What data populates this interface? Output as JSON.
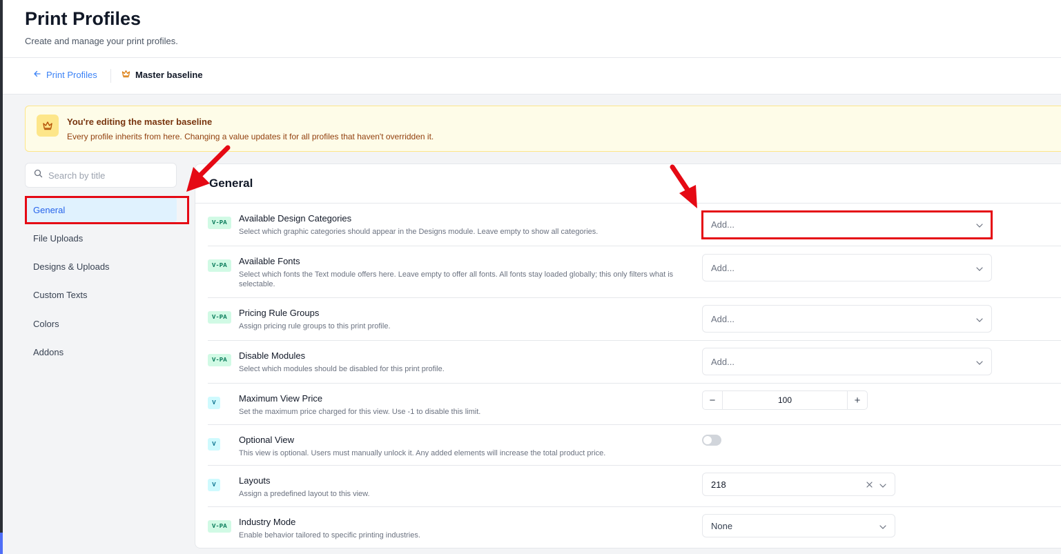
{
  "header": {
    "title": "Print Profiles",
    "subtitle": "Create and manage your print profiles."
  },
  "breadcrumb": {
    "back_label": "Print Profiles",
    "current_label": "Master baseline"
  },
  "banner": {
    "title": "You're editing the master baseline",
    "text": "Every profile inherits from here. Changing a value updates it for all profiles that haven't overridden it."
  },
  "sidebar": {
    "search_placeholder": "Search by title",
    "items": [
      {
        "label": "General",
        "active": true
      },
      {
        "label": "File Uploads"
      },
      {
        "label": "Designs & Uploads"
      },
      {
        "label": "Custom Texts"
      },
      {
        "label": "Colors"
      },
      {
        "label": "Addons"
      }
    ]
  },
  "main": {
    "section_title": "General",
    "settings": [
      {
        "badge": "V-PA",
        "label": "Available Design Categories",
        "desc": "Select which graphic categories should appear in the Designs module. Leave empty to show all categories.",
        "control": "multiselect",
        "placeholder": "Add..."
      },
      {
        "badge": "V-PA",
        "label": "Available Fonts",
        "desc": "Select which fonts the Text module offers here. Leave empty to offer all fonts. All fonts stay loaded globally; this only filters what is selectable.",
        "control": "multiselect",
        "placeholder": "Add..."
      },
      {
        "badge": "V-PA",
        "label": "Pricing Rule Groups",
        "desc": "Assign pricing rule groups to this print profile.",
        "control": "multiselect",
        "placeholder": "Add..."
      },
      {
        "badge": "V-PA",
        "label": "Disable Modules",
        "desc": "Select which modules should be disabled for this print profile.",
        "control": "multiselect",
        "placeholder": "Add..."
      },
      {
        "badge": "V",
        "label": "Maximum View Price",
        "desc": "Set the maximum price charged for this view. Use -1 to disable this limit.",
        "control": "stepper",
        "value": "100"
      },
      {
        "badge": "V",
        "label": "Optional View",
        "desc": "This view is optional. Users must manually unlock it. Any added elements will increase the total product price.",
        "control": "toggle",
        "value": false
      },
      {
        "badge": "V",
        "label": "Layouts",
        "desc": "Assign a predefined layout to this view.",
        "control": "select",
        "value": "218"
      },
      {
        "badge": "V-PA",
        "label": "Industry Mode",
        "desc": "Enable behavior tailored to specific printing industries.",
        "control": "select",
        "value": "None"
      }
    ]
  },
  "icons": {
    "back": "arrow-left-icon",
    "crown": "crown-icon",
    "search": "search-icon",
    "chevron": "chevron-down-icon",
    "clear": "close-icon"
  },
  "colors": {
    "accent": "#2563eb",
    "annotation": "#e50914",
    "banner_bg": "#fefce8"
  }
}
